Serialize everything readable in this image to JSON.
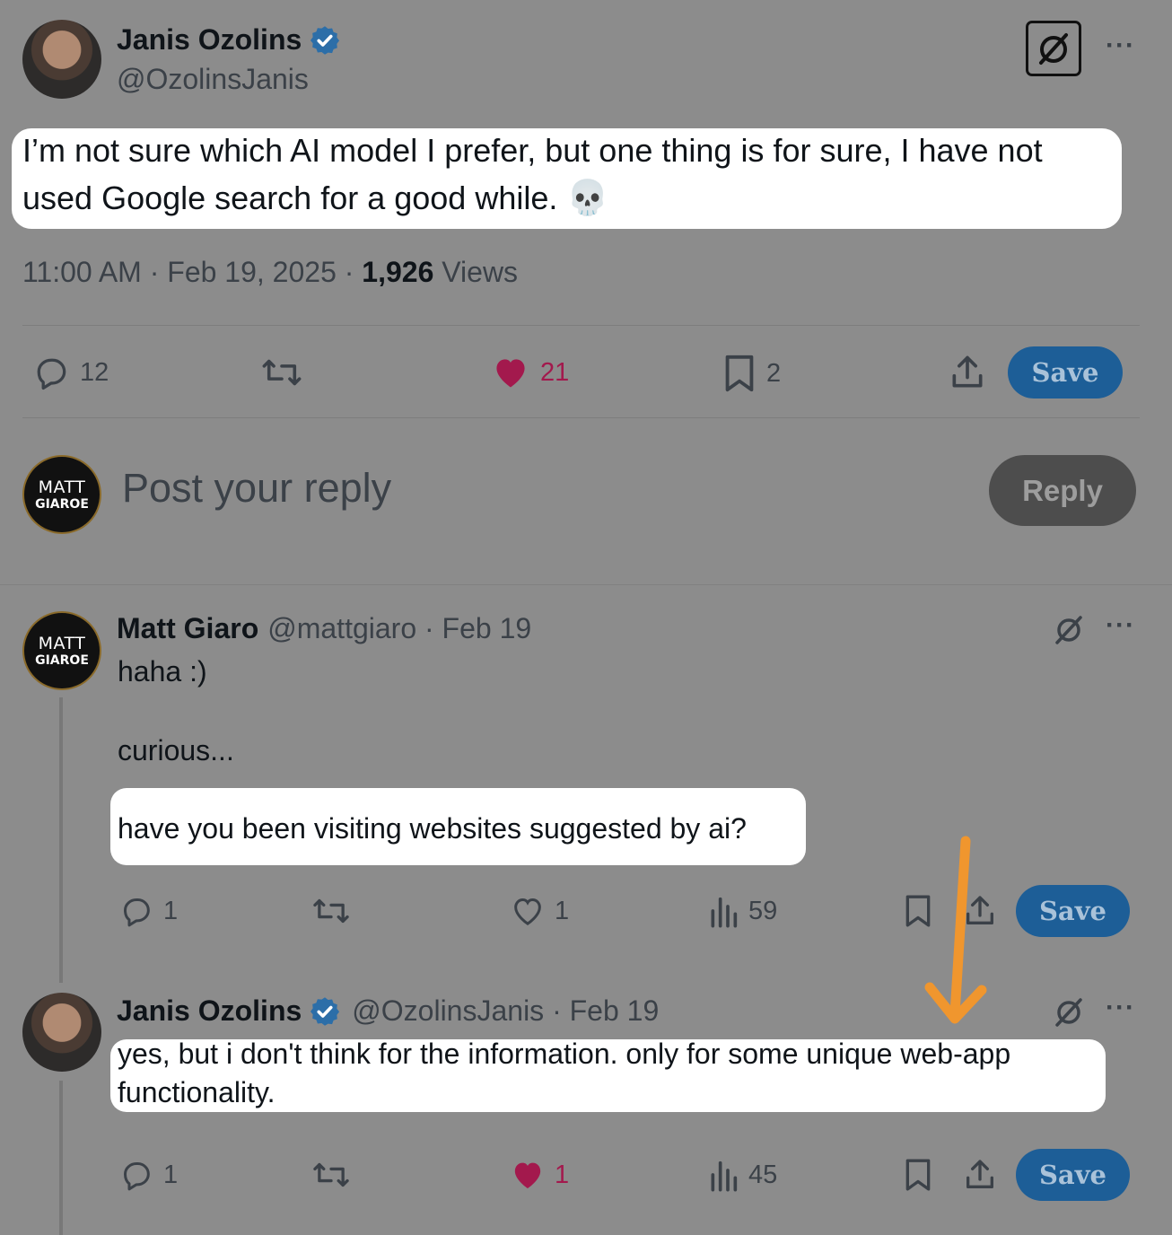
{
  "main_post": {
    "author_name": "Janis Ozolins",
    "author_handle": "@OzolinsJanis",
    "text_line1": "I’m not sure which AI model I prefer, but one thing is for sure, I have not",
    "text_line2": "used Google search for a good while.",
    "emoji": "💀",
    "time": "11:00 AM · Feb 19, 2025 · ",
    "views_count": "1,926",
    "views_label": " Views",
    "stats": {
      "replies": "12",
      "likes": "21",
      "bookmarks": "2"
    },
    "save_label": "Save"
  },
  "reply_box": {
    "avatar_line1": "MATT",
    "avatar_line2": "GIAROE",
    "placeholder": "Post your reply",
    "reply_label": "Reply"
  },
  "replies": [
    {
      "author_name": "Matt Giaro",
      "author_handle": "@mattgiaro · Feb 19",
      "avatar_line1": "MATT",
      "avatar_line2": "GIAROE",
      "line1": "haha :)",
      "line2": "curious...",
      "line3": "have you been visiting websites suggested by ai?",
      "stats": {
        "replies": "1",
        "likes": "1",
        "views": "59"
      },
      "save_label": "Save"
    },
    {
      "author_name": "Janis Ozolins",
      "author_handle": "@OzolinsJanis · Feb 19",
      "line1": "yes, but i don't think for the information. only for some unique web-app",
      "line2": "functionality.",
      "stats": {
        "replies": "1",
        "likes": "1",
        "views": "45"
      },
      "save_label": "Save"
    }
  ],
  "colors": {
    "background": "#8c8c8c",
    "highlight": "#ffffff",
    "like_pink": "#a3194d",
    "save_blue": "#1d5e97",
    "arrow_orange": "#f0962e"
  },
  "icons": [
    "grok-icon",
    "more-icon",
    "reply-icon",
    "retweet-icon",
    "heart-icon",
    "bookmark-icon",
    "share-icon",
    "views-icon",
    "verified-icon"
  ]
}
